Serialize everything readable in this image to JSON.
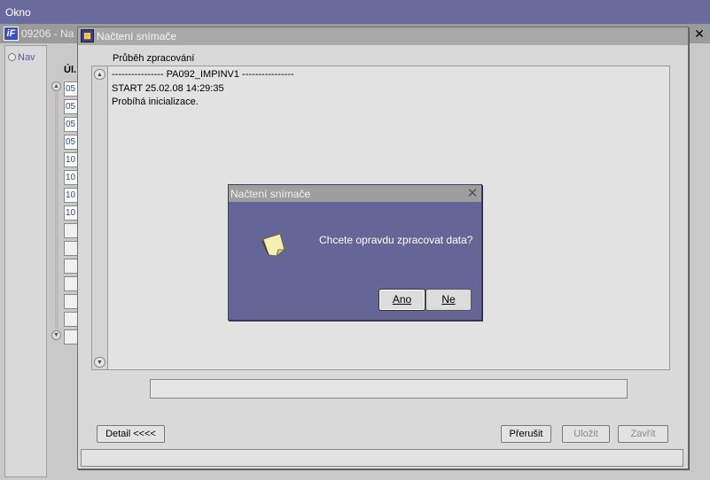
{
  "app": {
    "title": "Okno"
  },
  "form": {
    "title": "09206 - Na",
    "app_icon_text": "iF",
    "close_glyph": "✕",
    "nav_label": "Nav",
    "column_header": "Úl.",
    "rows": [
      "05",
      "05",
      "05",
      "05",
      "10",
      "10",
      "10",
      "10",
      "",
      "",
      "",
      "",
      "",
      "",
      "",
      ""
    ]
  },
  "process_window": {
    "title": "Načtení snímače",
    "progress_label": "Průběh zpracování",
    "log_lines": [
      "---------------- PA092_IMPINV1 ----------------",
      "START 25.02.08 14:29:35",
      "Probíhá inicializace."
    ],
    "status_value": "",
    "buttons": {
      "detail": "Detail  <<<<",
      "prerusit": "Přerušit",
      "ulozit": "Uložit",
      "zavrit": "Zavřít"
    }
  },
  "dialog": {
    "title": "Načtení snímače",
    "message": "Chcete opravdu zpracovat data?",
    "close_glyph": "✕",
    "yes_label": "Ano",
    "no_label": "Ne",
    "icon": "note-icon"
  },
  "colors": {
    "titlebar": "#6a6a9c",
    "dialog_bg": "#656598",
    "window_bg": "#d9d9d9"
  }
}
